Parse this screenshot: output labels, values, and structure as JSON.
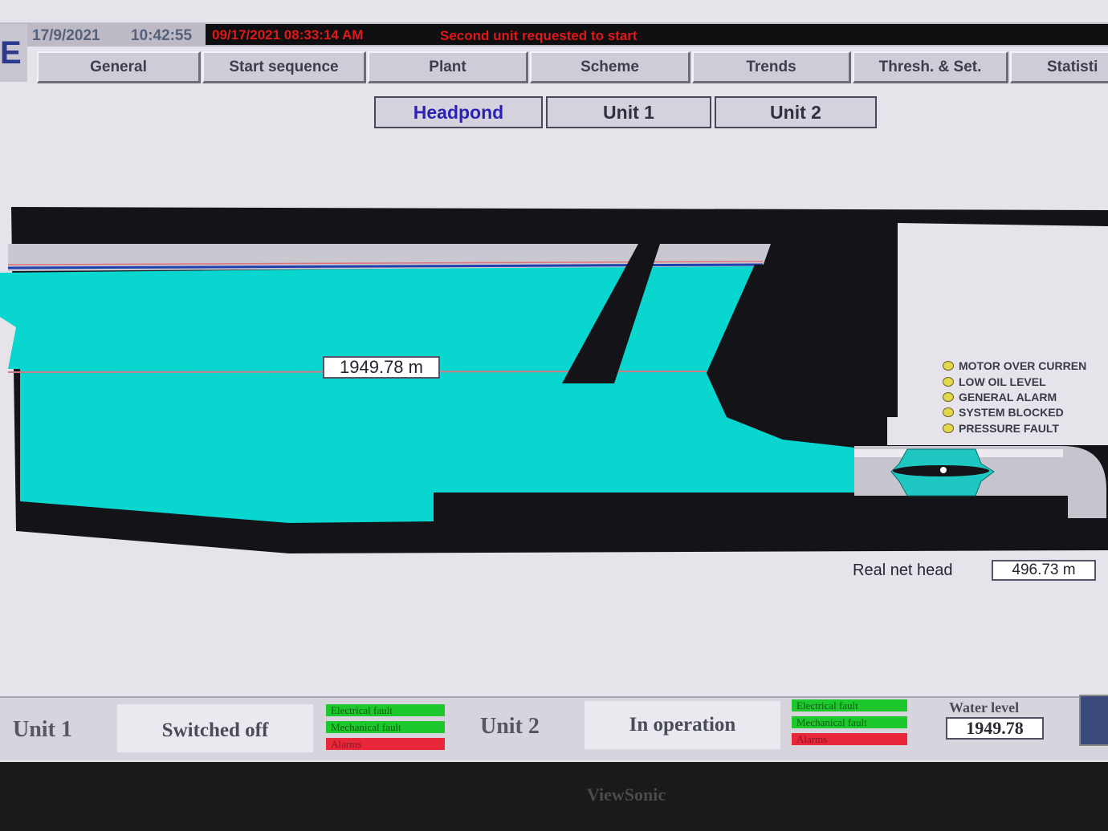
{
  "header": {
    "date": "17/9/2021",
    "time": "10:42:55",
    "alarm_timestamp": "09/17/2021 08:33:14 AM",
    "alarm_message": "Second unit requested to start",
    "logo_letter": "E"
  },
  "nav": {
    "tabs": [
      "General",
      "Start sequence",
      "Plant",
      "Scheme",
      "Trends",
      "Thresh. & Set.",
      "Statisti"
    ]
  },
  "subnav": {
    "tabs": [
      "Headpond",
      "Unit 1",
      "Unit 2"
    ],
    "active": "Headpond"
  },
  "scheme": {
    "headpond_level": "1949.78 m",
    "real_net_head_label": "Real net head",
    "real_net_head_value": "496.73 m",
    "indicators": [
      "MOTOR OVER CURREN",
      "LOW OIL LEVEL",
      "GENERAL ALARM",
      "SYSTEM BLOCKED",
      "PRESSURE FAULT"
    ],
    "water_color": "#08d6cf",
    "indicator_color": "#e2d84a"
  },
  "units": [
    {
      "name": "Unit 1",
      "state": "Switched off",
      "flags": [
        "Electrical fault",
        "Mechanical fault",
        "Alarms"
      ]
    },
    {
      "name": "Unit 2",
      "state": "In operation",
      "flags": [
        "Electrical fault",
        "Mechanical fault",
        "Alarms"
      ]
    }
  ],
  "water_level": {
    "label": "Water level",
    "value": "1949.78"
  },
  "monitor": {
    "brand": "ViewSonic"
  }
}
